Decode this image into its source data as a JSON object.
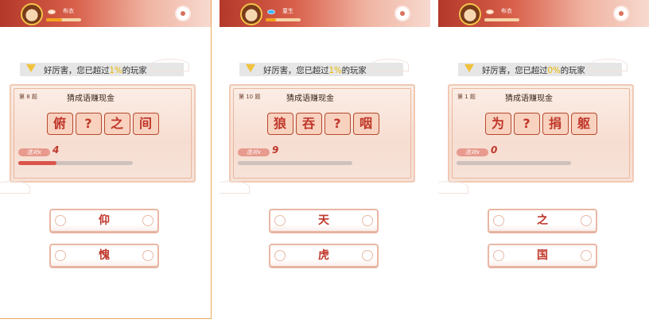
{
  "panels": [
    {
      "rank": "布衣",
      "xp_fraction": 0.45,
      "banner": {
        "prefix": "好厉害，您已超过",
        "percent": "1%",
        "suffix": "的玩家"
      },
      "question_num": "第 8 题",
      "title": "猜成语赚现金",
      "tiles": [
        "俯",
        "?",
        "之",
        "间"
      ],
      "streak_label": "连对x",
      "streak": "4",
      "progress_fraction": 0.33,
      "answers": [
        "仰",
        "愧"
      ]
    },
    {
      "rank": "童生",
      "xp_fraction": 0.3,
      "banner": {
        "prefix": "好厉害，您已超过",
        "percent": "1%",
        "suffix": "的玩家"
      },
      "question_num": "第 10 题",
      "title": "猜成语赚现金",
      "tiles": [
        "狼",
        "吞",
        "?",
        "咽"
      ],
      "streak_label": "连对x",
      "streak": "9",
      "progress_fraction": 0.0,
      "answers": [
        "天",
        "虎"
      ]
    },
    {
      "rank": "布衣",
      "xp_fraction": 0.0,
      "banner": {
        "prefix": "好厉害，您已超过",
        "percent": "0%",
        "suffix": "的玩家"
      },
      "question_num": "第 1 题",
      "title": "猜成语赚现金",
      "tiles": [
        "为",
        "?",
        "捐",
        "躯"
      ],
      "streak_label": "连对x",
      "streak": "0",
      "progress_fraction": 0.0,
      "answers": [
        "之",
        "国"
      ]
    }
  ],
  "colors": {
    "accent": "#c0362a",
    "highlight": "#e8b600",
    "header": "#b3382a"
  },
  "icons": [
    "avatar",
    "eye-icon",
    "settings-icon",
    "trophy-icon",
    "swirl-icon"
  ]
}
